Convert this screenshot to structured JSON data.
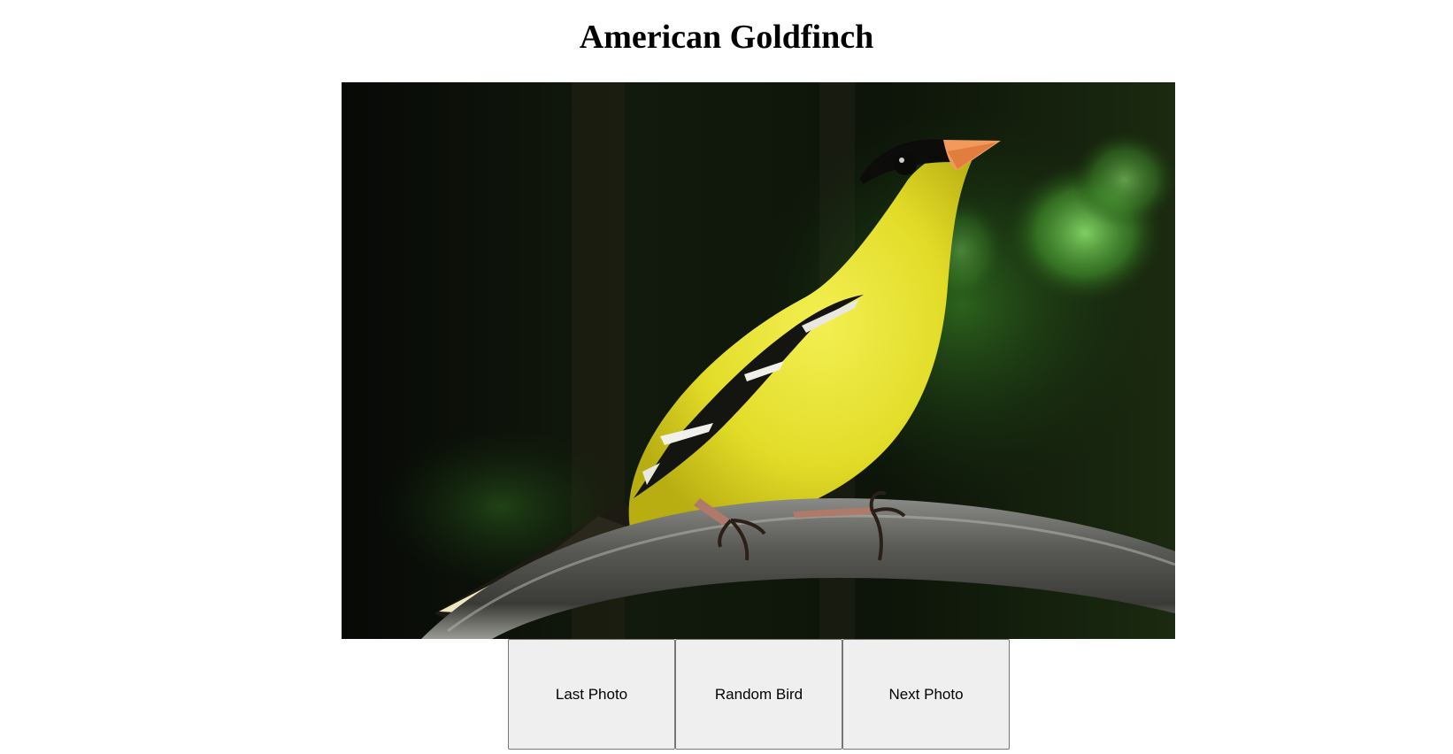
{
  "page": {
    "title": "American Goldfinch"
  },
  "photo": {
    "subject": "american-goldfinch-bird"
  },
  "controls": {
    "last_label": "Last Photo",
    "random_label": "Random Bird",
    "next_label": "Next Photo"
  },
  "colors": {
    "button_bg": "#efefef",
    "button_border": "#767676",
    "bird_yellow": "#e6e12a",
    "beak_orange": "#f19a5c"
  }
}
